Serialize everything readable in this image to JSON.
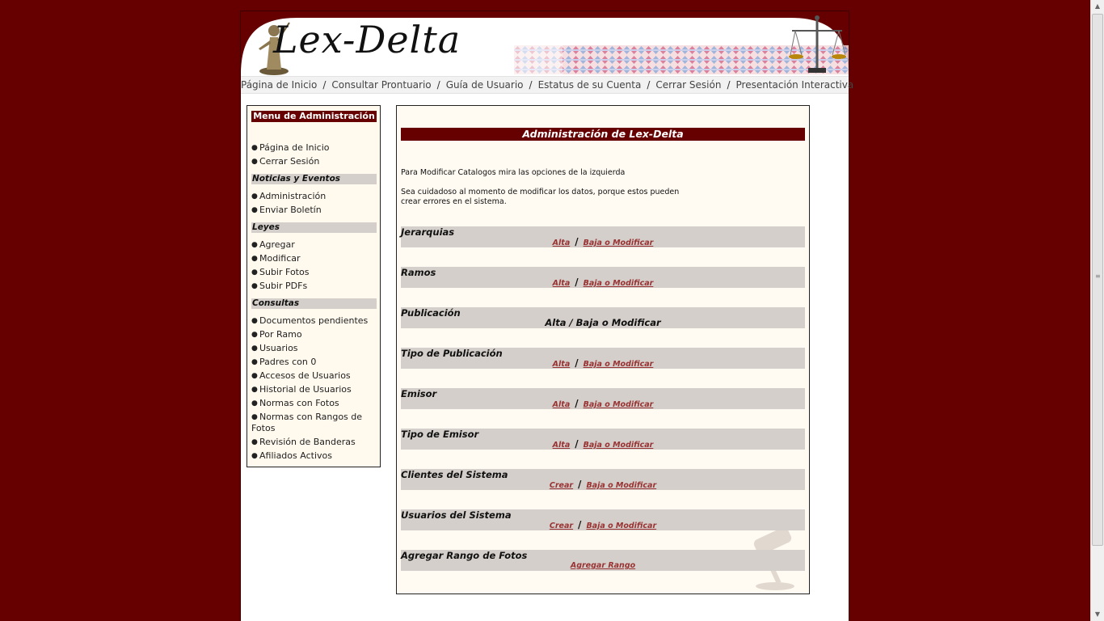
{
  "header": {
    "logo_text": "Lex-Delta"
  },
  "nav": {
    "items": [
      "Página de Inicio",
      "Consultar Prontuario",
      "Guía de Usuario",
      "Estatus de su Cuenta",
      "Cerrar Sesión",
      "Presentación Interactiva"
    ],
    "separator": "/"
  },
  "menu": {
    "title": "Menu de Administración",
    "general": [
      "Página de Inicio",
      "Cerrar Sesión"
    ],
    "sections": [
      {
        "title": "Noticias y Eventos",
        "items": [
          "Administración",
          "Enviar Boletín"
        ]
      },
      {
        "title": "Leyes",
        "items": [
          "Agregar",
          "Modificar",
          "Subir Fotos",
          "Subir PDFs"
        ]
      },
      {
        "title": "Consultas",
        "items": [
          "Documentos pendientes",
          "Por Ramo",
          "Usuarios",
          "Padres con 0",
          "Accesos de Usuarios",
          "Historial de Usuarios",
          "Normas con Fotos",
          "Normas con Rangos de Fotos",
          "Revisión de Banderas",
          "Afiliados Activos"
        ]
      }
    ]
  },
  "main": {
    "title": "Administración de Lex-Delta",
    "intro1": "Para Modificar Catalogos mira las opciones de la izquierda",
    "intro2a": "Sea cuidadoso al momento de modificar los datos, porque estos pueden",
    "intro2b": "crear errores en el sistema.",
    "separator": "/",
    "catalogs": [
      {
        "name": "Jerarquias",
        "action1": "Alta",
        "action2": "Baja o Modificar"
      },
      {
        "name": "Ramos",
        "action1": "Alta",
        "action2": "Baja o Modificar"
      },
      {
        "name": "Publicación",
        "plain": "Alta / Baja o Modificar"
      },
      {
        "name": "Tipo de Publicación",
        "action1": "Alta",
        "action2": "Baja o Modificar"
      },
      {
        "name": "Emisor",
        "action1": "Alta",
        "action2": "Baja o Modificar"
      },
      {
        "name": "Tipo de Emisor",
        "action1": "Alta",
        "action2": "Baja o Modificar"
      },
      {
        "name": "Clientes del Sistema",
        "action1": "Crear",
        "action2": "Baja o Modificar"
      },
      {
        "name": "Usuarios del Sistema",
        "action1": "Crear",
        "action2": "Baja o Modificar"
      },
      {
        "name": "Agregar Rango de Fotos",
        "single": "Agregar Rango"
      }
    ]
  },
  "colors": {
    "background": "#660000",
    "accent": "#660000",
    "link": "#993333",
    "section_bg": "#d4cfca"
  }
}
